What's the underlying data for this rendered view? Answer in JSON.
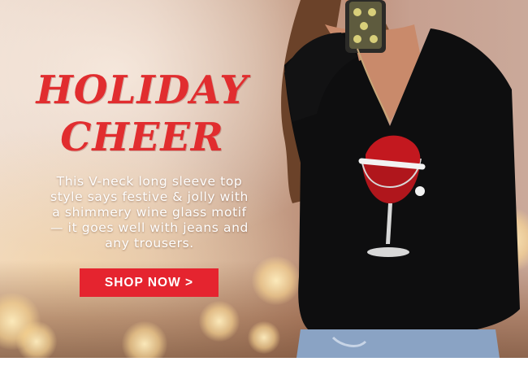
{
  "banner": {
    "headline_line1": "HOLIDAY",
    "headline_line2": "CHEER",
    "description_lines": [
      "This V-neck long sleeve top",
      "style says festive & jolly with",
      "a shimmery wine glass motif",
      "—  it goes well with jeans and",
      "any trousers."
    ],
    "cta_label": "SHOP NOW >"
  },
  "colors": {
    "headline": "#e12d2f",
    "cta_background": "#e5242f",
    "top": "#0e0e0f",
    "description_text": "#ffffff"
  },
  "icons": {
    "product_motif": "wine-glass-santa-hat"
  }
}
